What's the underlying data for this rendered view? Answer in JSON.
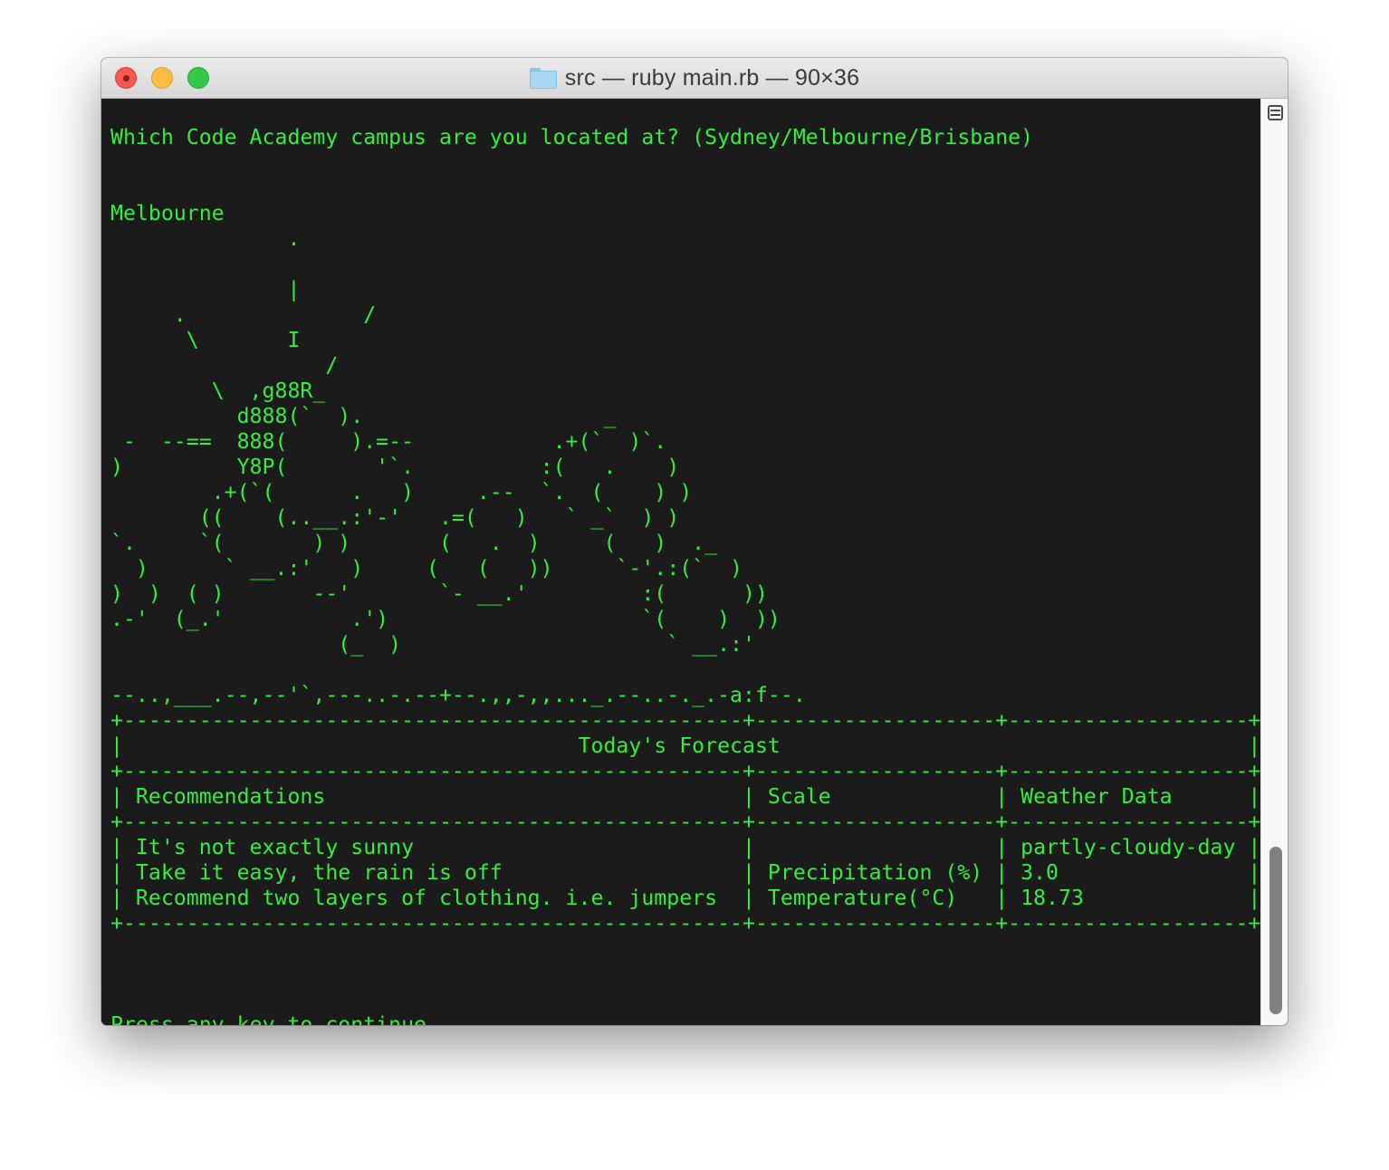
{
  "window": {
    "title": "src — ruby main.rb — 90×36",
    "title_icon": "folder-icon"
  },
  "terminal": {
    "text_color": "#33ee3d",
    "background": "#1b1b1b",
    "lines": [
      "",
      "Which Code Academy campus are you located at? (Sydney/Melbourne/Brisbane)",
      "",
      "",
      "Melbourne",
      "              .",
      "",
      "              |",
      "     .              /",
      "      \\       I",
      "                 /",
      "        \\  ,g88R_",
      "          d888(`  ).                   _",
      " -  --==  888(     ).=--           .+(`  )`.",
      ")         Y8P(       '`.          :(   .    )",
      "        .+(`(      .   )     .--  `.  (    ) )",
      "       ((    (..__.:'-'   .=(   )   ` _`  ) )",
      "`.     `(       ) )       (   .  )     (   )  ._",
      "  )      ` __.:'   )     (   (   ))     `-'.:(`  )",
      ")  )  ( )       --'       `- __.'         :(      ))",
      ".-'  (_.'          .')                    `(    )  ))",
      "                  (_  )                     ` __.:'",
      "",
      "--..,___.--,--'`,---..-.--+--.,,-,,..._.--..-._.-a:f--.",
      "+-------------------------------------------------+-------------------+-------------------+",
      "|                                    Today's Forecast                                     |",
      "+-------------------------------------------------+-------------------+-------------------+",
      "| Recommendations                                 | Scale             | Weather Data      |",
      "+-------------------------------------------------+-------------------+-------------------+",
      "| It's not exactly sunny                          |                   | partly-cloudy-day |",
      "| Take it easy, the rain is off                   | Precipitation (%) | 3.0               |",
      "| Recommend two layers of clothing. i.e. jumpers  | Temperature(°C)   | 18.73             |",
      "+-------------------------------------------------+-------------------+-------------------+",
      "",
      "",
      "",
      "Press any key to continue"
    ]
  },
  "scrollbar": {
    "position": 0.88,
    "split_icon": "split-pane-icon"
  }
}
